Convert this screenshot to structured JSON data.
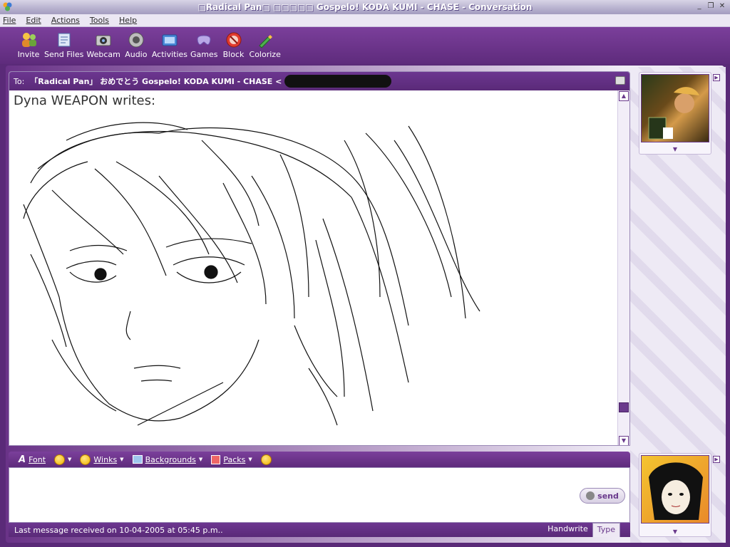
{
  "window": {
    "title": "□Radical Pan□ □□□□□ Gospelo! KODA KUMI - CHASE - Conversation"
  },
  "menu": [
    {
      "label": "File"
    },
    {
      "label": "Edit"
    },
    {
      "label": "Actions"
    },
    {
      "label": "Tools"
    },
    {
      "label": "Help"
    }
  ],
  "toolbar": {
    "buttons": [
      {
        "label": "Invite",
        "icon": "invite-icon"
      },
      {
        "label": "Send Files",
        "icon": "send-files-icon"
      },
      {
        "label": "Webcam",
        "icon": "webcam-icon"
      },
      {
        "label": "Audio",
        "icon": "audio-icon"
      },
      {
        "label": "Activities",
        "icon": "activities-icon"
      },
      {
        "label": "Games",
        "icon": "games-icon"
      },
      {
        "label": "Block",
        "icon": "block-icon"
      },
      {
        "label": "Colorize",
        "icon": "colorize-icon"
      }
    ]
  },
  "conversation": {
    "to_label": "To:",
    "to_name": "「Radical Pan」 おめでとう Gospelo! KODA KUMI - CHASE <",
    "message_header": "Dyna WEAPON writes:"
  },
  "input_toolbar": {
    "font_label": "Font",
    "winks_label": "Winks",
    "backgrounds_label": "Backgrounds",
    "packs_label": "Packs"
  },
  "send": {
    "label": "send"
  },
  "status": {
    "text": "Last message received on 10-04-2005 at 05:45 p.m..",
    "modes": [
      {
        "label": "Handwrite",
        "active": false
      },
      {
        "label": "Type",
        "active": true
      }
    ]
  },
  "colors": {
    "accent": "#6a3a8c",
    "toolbar": "#5e2b7c"
  }
}
